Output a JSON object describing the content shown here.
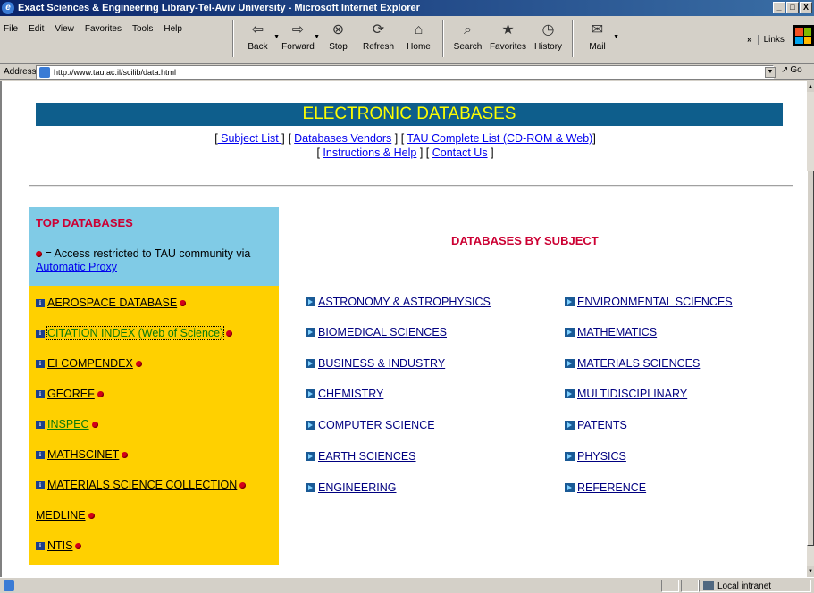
{
  "window": {
    "title": "Exact Sciences & Engineering Library-Tel-Aviv University - Microsoft Internet Explorer",
    "controls": [
      "_",
      "□",
      "X"
    ]
  },
  "menu": [
    "File",
    "Edit",
    "View",
    "Favorites",
    "Tools",
    "Help"
  ],
  "toolbar": {
    "buttons": [
      {
        "label": "Back",
        "icon": "back-arrow-icon"
      },
      {
        "label": "Forward",
        "icon": "forward-arrow-icon"
      },
      {
        "label": "Stop",
        "icon": "stop-icon"
      },
      {
        "label": "Refresh",
        "icon": "refresh-icon"
      },
      {
        "label": "Home",
        "icon": "home-icon"
      },
      {
        "label": "Search",
        "icon": "search-icon"
      },
      {
        "label": "Favorites",
        "icon": "favorites-icon"
      },
      {
        "label": "History",
        "icon": "history-icon"
      },
      {
        "label": "Mail",
        "icon": "mail-icon"
      }
    ],
    "links_label": "Links",
    "chevron": "»"
  },
  "address": {
    "label": "Address",
    "url": "http://www.tau.ac.il/scilib/data.html",
    "go_label": "Go"
  },
  "page": {
    "banner": "ELECTRONIC DATABASES",
    "nav": {
      "open": "[",
      "subject_list": " Subject List ",
      "sep1": "] [",
      "vendors": "Databases Vendors",
      "sep2": "] [",
      "tau_complete": "TAU Complete List (CD-ROM & Web)",
      "close1": "]",
      "open2": "[",
      "instructions": "Instructions & Help",
      "sep3": "] [",
      "contact": "Contact Us",
      "close2": "]"
    },
    "top_databases": {
      "title": "TOP DATABASES",
      "note_prefix": " = Access restricted to TAU community via ",
      "proxy_link": "Automatic Proxy",
      "items": [
        {
          "label": "AEROSPACE DATABASE "
        },
        {
          "label": "CITATION INDEX (Web of Science) "
        },
        {
          "label": "EI COMPENDEX "
        },
        {
          "label": "GEOREF "
        },
        {
          "label": "INSPEC "
        },
        {
          "label": "MATHSCINET "
        },
        {
          "label": "MATERIALS SCIENCE COLLECTION "
        },
        {
          "label": "MEDLINE "
        },
        {
          "label": "NTIS "
        }
      ]
    },
    "by_subject": {
      "title": "DATABASES BY SUBJECT",
      "left": [
        " ASTRONOMY & ASTROPHYSICS",
        " BIOMEDICAL SCIENCES",
        " BUSINESS & INDUSTRY",
        " CHEMISTRY",
        " COMPUTER SCIENCE",
        " EARTH SCIENCES",
        " ENGINEERING"
      ],
      "right": [
        " ENVIRONMENTAL SCIENCES",
        " MATHEMATICS",
        "MATERIALS SCIENCES",
        " MULTIDISCIPLINARY",
        " PATENTS",
        " PHYSICS",
        " REFERENCE"
      ]
    }
  },
  "status": {
    "zone": "Local intranet"
  },
  "colors": {
    "banner_bg": "#0e5e8c",
    "banner_text": "#ffff00",
    "top_box": "#80cbe6",
    "yellow_box": "#ffd000",
    "heading_red": "#cc0033"
  }
}
